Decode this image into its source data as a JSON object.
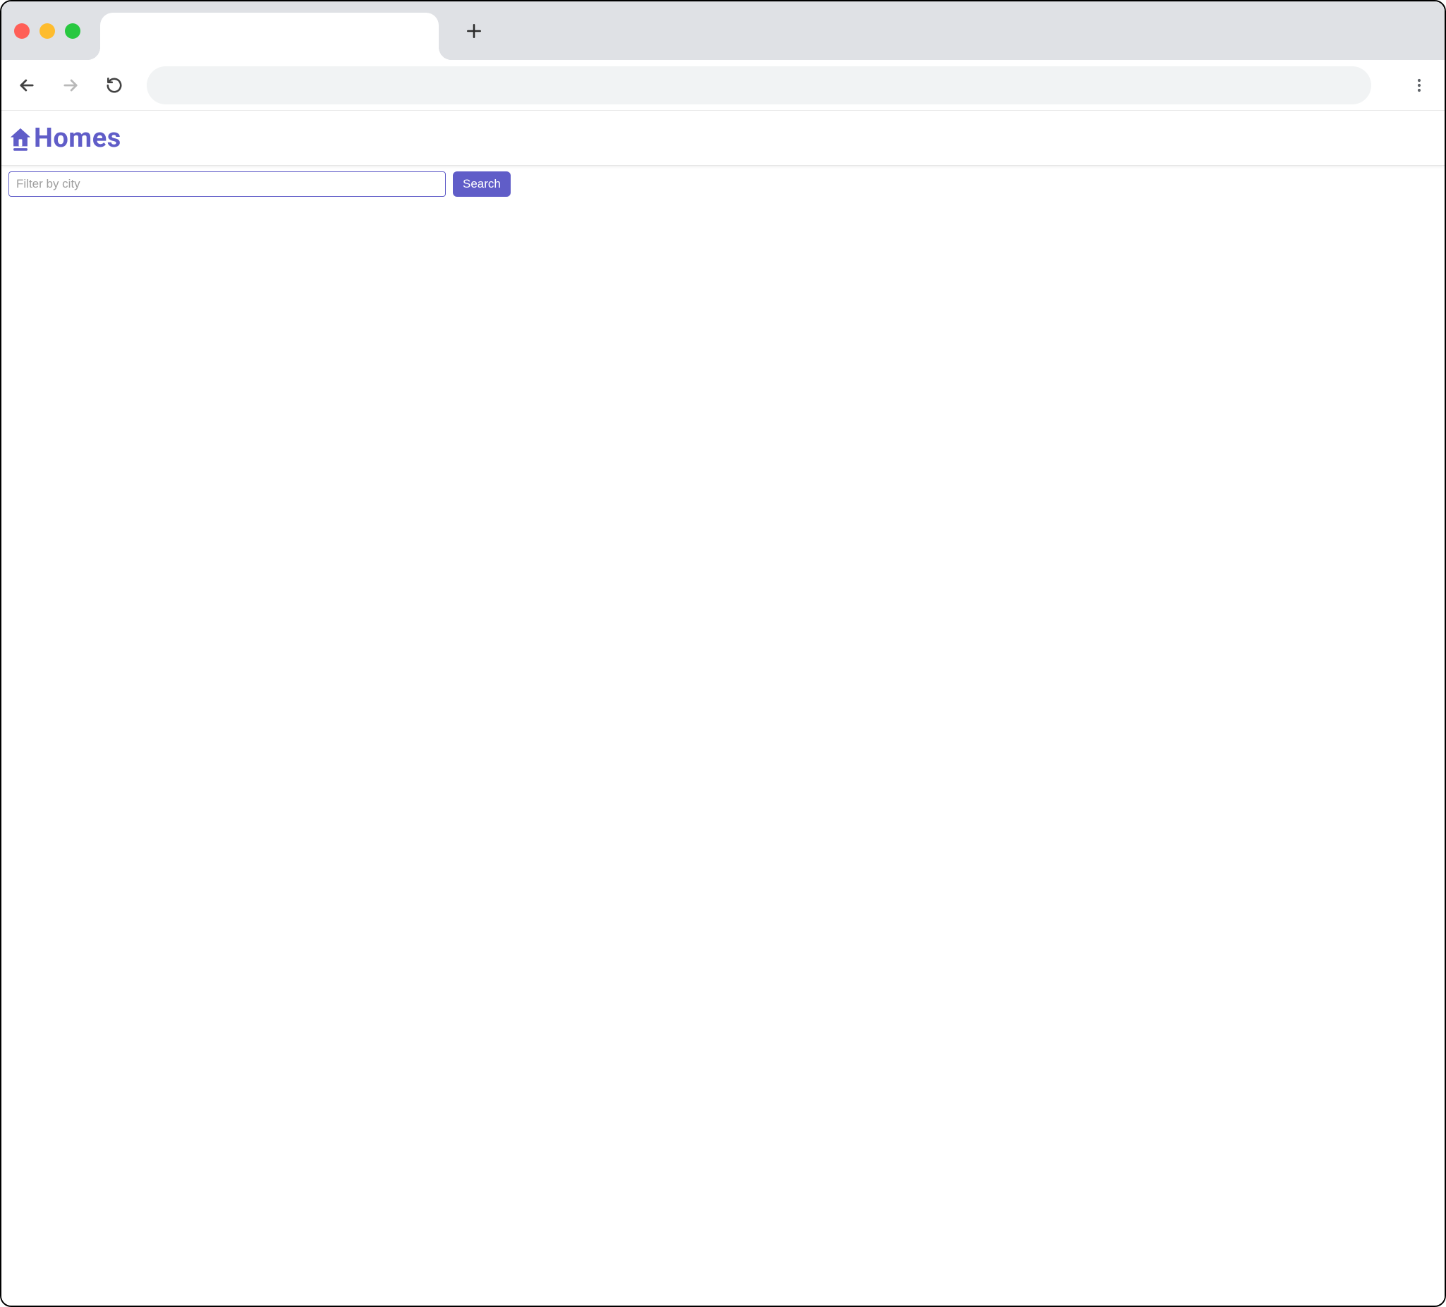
{
  "colors": {
    "accent": "#605dc8"
  },
  "header": {
    "brand": "Homes"
  },
  "search": {
    "placeholder": "Filter by city",
    "value": "",
    "button_label": "Search"
  }
}
